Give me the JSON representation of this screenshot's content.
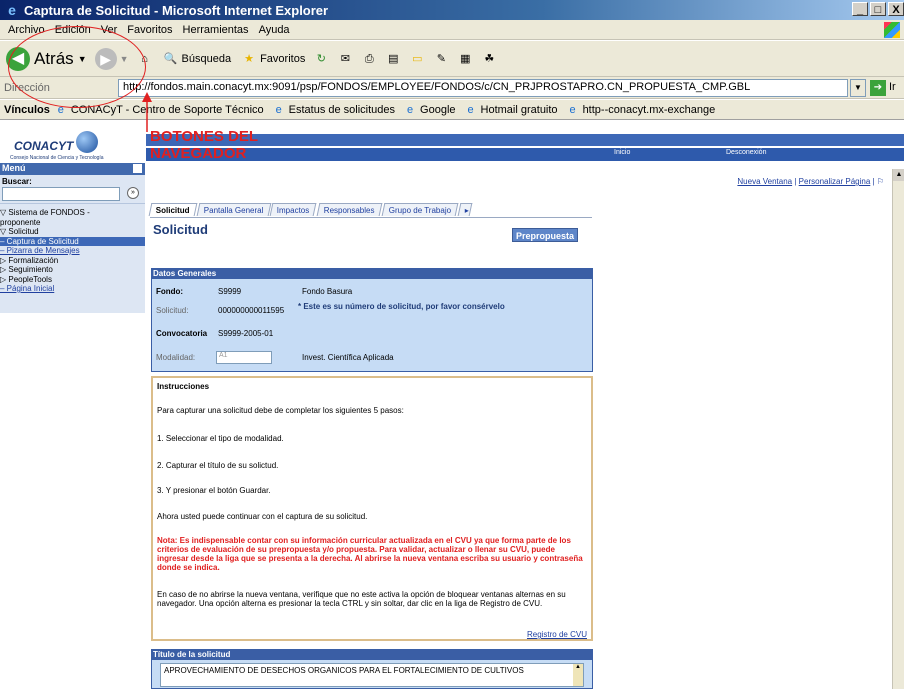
{
  "window": {
    "title": "Captura de Solicitud - Microsoft Internet Explorer",
    "controls": [
      "_",
      "□",
      "X"
    ]
  },
  "menubar": [
    "Archivo",
    "Edición",
    "Ver",
    "Favoritos",
    "Herramientas",
    "Ayuda"
  ],
  "toolbar": {
    "back_label": "Atrás",
    "search_label": "Búsqueda",
    "favorites_label": "Favoritos"
  },
  "address": {
    "label": "Dirección",
    "url": "http://fondos.main.conacyt.mx:9091/psp/FONDOS/EMPLOYEE/FONDOS/c/CN_PRJPROSTAPRO.CN_PROPUESTA_CMP.GBL",
    "go_label": "Ir"
  },
  "links": {
    "label": "Vínculos",
    "items": [
      "CONACyT - Centro de Soporte Técnico",
      "Estatus de solicitudes",
      "Google",
      "Hotmail gratuito",
      "http--conacyt.mx-exchange"
    ]
  },
  "annotation": {
    "line1": "BOTONES DEL",
    "line2": "NAVEGADOR"
  },
  "header": {
    "logo_text": "CONACYT",
    "logo_sub": "Consejo Nacional de Ciencia y Tecnología",
    "inicio": "Inicio",
    "desconexion": "Desconexión"
  },
  "sidebar": {
    "title": "Menú",
    "search_label": "Buscar:",
    "search_value": "",
    "search_go": "»",
    "tree": [
      "▽ Sistema de FONDOS -",
      "   proponente",
      "   ▽ Solicitud",
      "      – Captura de Solicitud",
      "      – Pizarra de Mensajes",
      "   ▷ Formalización",
      "   ▷ Seguimiento",
      "▷ PeopleTools",
      "– Página Inicial"
    ]
  },
  "toplinks": {
    "nueva_ventana": "Nueva Ventana",
    "separator": "|",
    "personalizar": "Personalizar Página",
    "separator2": "|"
  },
  "tabs": [
    "Solicitud",
    "Pantalla General",
    "Impactos",
    "Responsables",
    "Grupo de Trabajo"
  ],
  "page": {
    "title": "Solicitud",
    "preprop_button": "Prepropuesta"
  },
  "datos": {
    "header": "Datos Generales",
    "fondo_label": "Fondo:",
    "fondo_code": "S9999",
    "fondo_name": "Fondo Basura",
    "solicitud_label": "Solicitud:",
    "solicitud_num": "000000000011595",
    "solicitud_note": "* Este es su número de solicitud, por favor consérvelo",
    "convocatoria_label": "Convocatoria",
    "convocatoria_val": "S9999-2005-01",
    "modalidad_label": "Modalidad:",
    "modalidad_code": "A1",
    "modalidad_name": "Invest. Científica Aplicada"
  },
  "instrucciones": {
    "title": "Instrucciones",
    "intro": "Para capturar una solicitud debe de completar los siguientes 5 pasos:",
    "step1": "1. Seleccionar el tipo de modalidad.",
    "step2": "2. Capturar el título de su solictud.",
    "step3": "3. Y presionar el botón Guardar.",
    "continue": "Ahora usted puede continuar con el captura de su solicitud.",
    "nota": "Nota: Es indispensable contar con su información curricular actualizada en el CVU ya que forma parte de los criterios de evaluación de su prepropuesta y/o propuesta. Para validar, actualizar o llenar su CVU, puede ingresar desde la liga que se presenta a la derecha. Al abrirse la nueva ventana escriba su usuario y contraseña donde se indica.",
    "popup": "En caso de no abrirse la nueva ventana, verifique que no este activa la opción de bloquear ventanas alternas en su navegador. Una opción alterna es presionar la tecla CTRL y sin soltar, dar clic en la liga de Registro de CVU.",
    "registro_link": "Registro de CVU"
  },
  "titulo": {
    "header": "Título de la solicitud",
    "value": "APROVECHAMIENTO DE DESECHOS ORGANICOS PARA EL FORTALECIMIENTO DE CULTIVOS"
  }
}
